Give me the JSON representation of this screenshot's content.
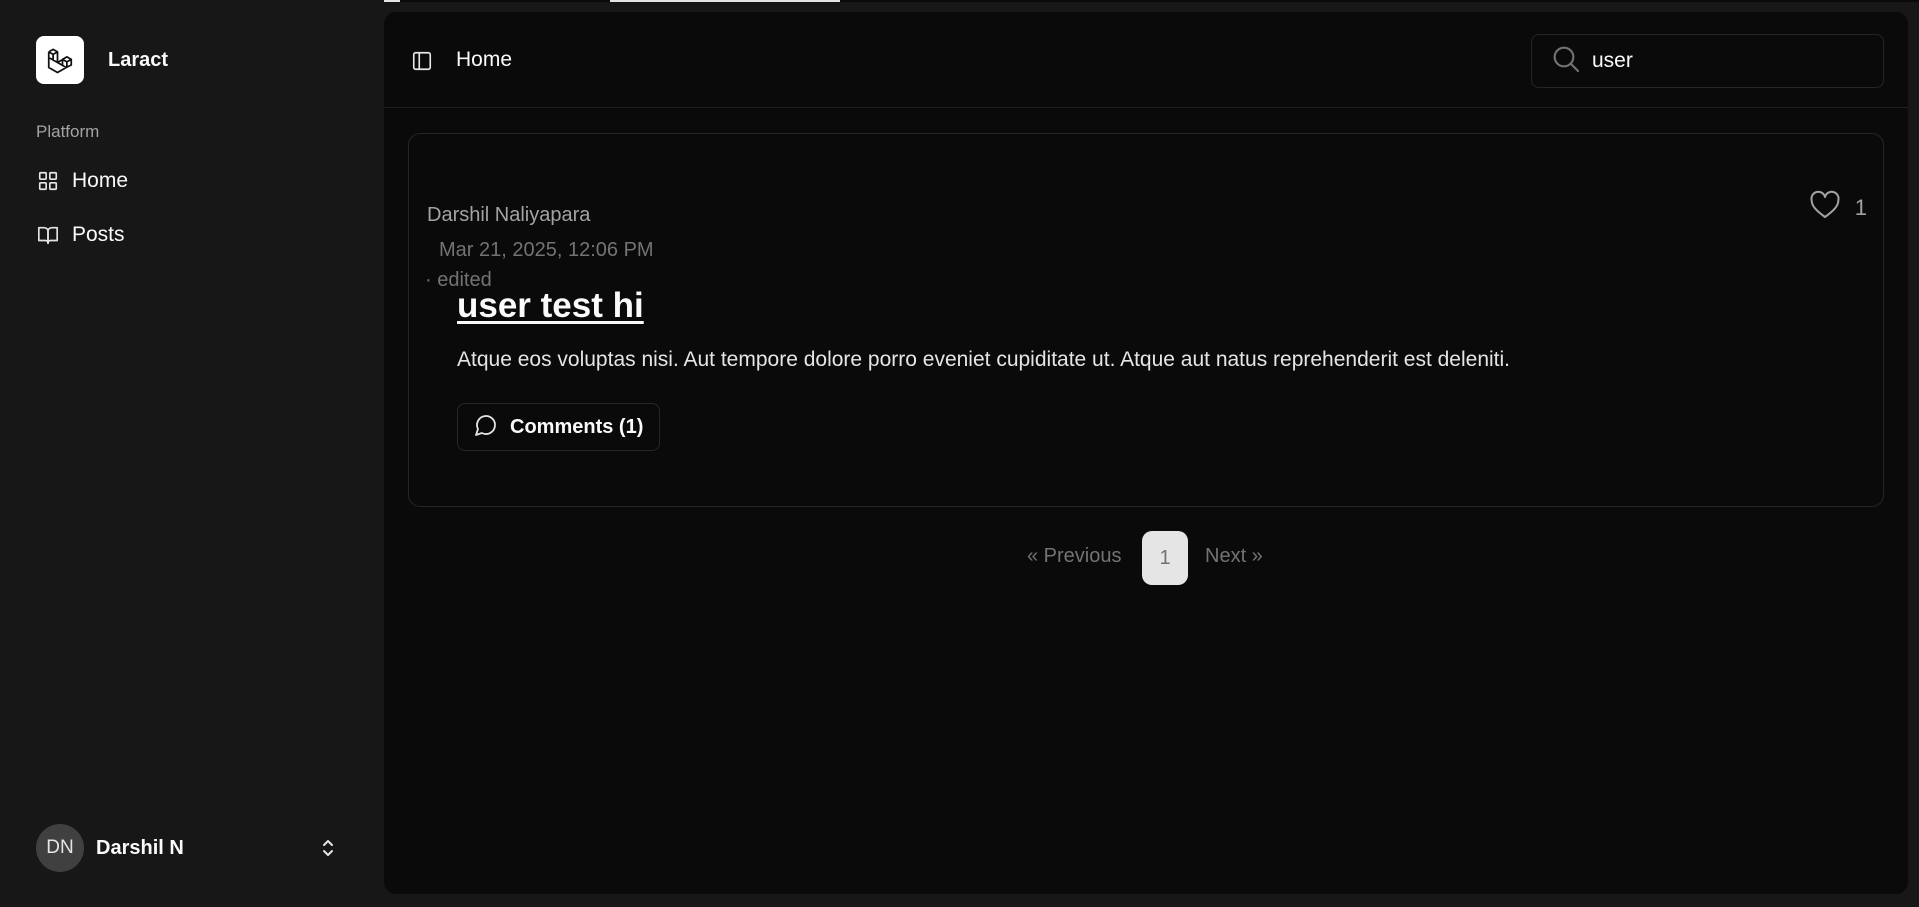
{
  "app": {
    "name": "Laract",
    "logo_icon": "laravel-logo-icon"
  },
  "sidebar": {
    "group_label": "Platform",
    "items": [
      {
        "label": "Home",
        "icon": "grid-icon"
      },
      {
        "label": "Posts",
        "icon": "book-open-icon"
      }
    ],
    "user": {
      "initials": "DN",
      "name": "Darshil N"
    }
  },
  "header": {
    "breadcrumb": "Home",
    "search": {
      "value": "user",
      "placeholder": ""
    }
  },
  "posts": [
    {
      "author": "Darshil Naliyapara",
      "date": "Mar 21, 2025, 12:06 PM",
      "edited": "· edited",
      "likes": "1",
      "title": "user test hi",
      "body": "Atque eos voluptas nisi. Aut tempore dolore porro eveniet cupiditate ut. Atque aut natus reprehenderit est deleniti.",
      "comments_label": "Comments (1)"
    }
  ],
  "pagination": {
    "previous": "« Previous",
    "current": "1",
    "next": "Next »"
  },
  "colors": {
    "sidebar_bg": "#171717",
    "main_bg": "#0a0a0a",
    "border": "#262626",
    "muted": "#737373"
  }
}
